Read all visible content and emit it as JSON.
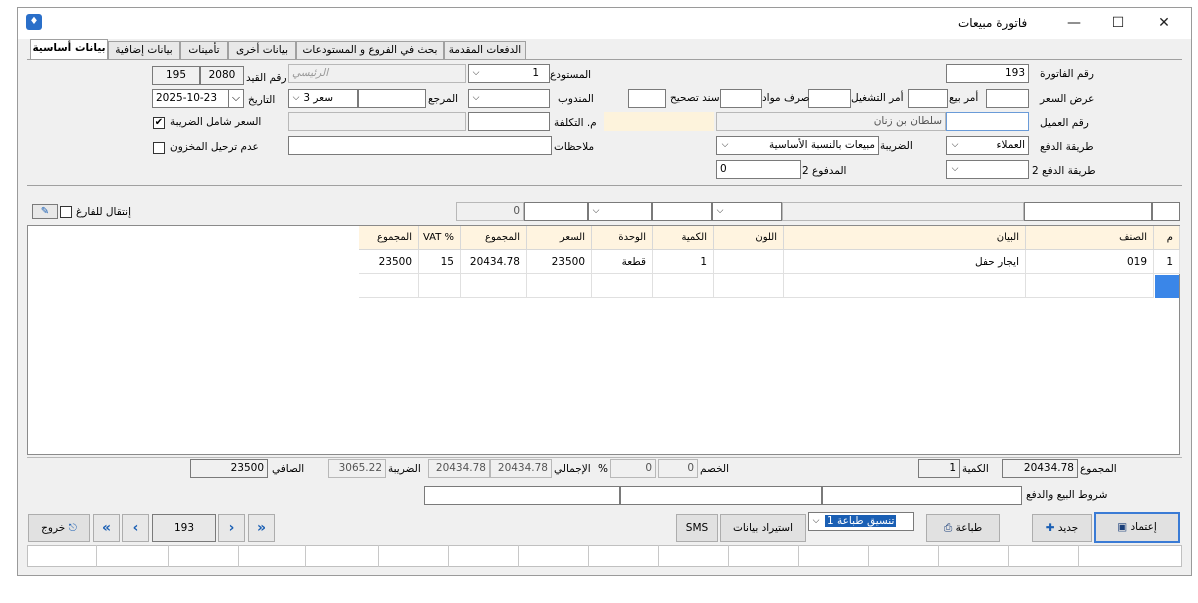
{
  "window": {
    "title": "فاتورة مبيعات",
    "minimize": "—",
    "maximize": "☐",
    "close": "✕"
  },
  "tabs": [
    {
      "label": "بيانات أساسية"
    },
    {
      "label": "بيانات إضافية"
    },
    {
      "label": "تأمينات"
    },
    {
      "label": "بيانات أخرى"
    },
    {
      "label": "بحث في الفروع و المستودعات"
    },
    {
      "label": "الدفعات المقدمة"
    }
  ],
  "form": {
    "invoice_no_label": "رقم الفاتورة",
    "invoice_no": "193",
    "price_offer_label": "عرض السعر",
    "sale_order_label": "أمر بيع",
    "operation_order_label": "أمر التشغيل",
    "material_issue_label": "صرف مواد",
    "adjustment_label": "سند تصحيح",
    "client_no_label": "رقم العميل",
    "client_name": "سلطان بن زنان",
    "payment_method_label": "طريقة الدفع",
    "payment_method": "العملاء",
    "tax_label": "الضريبة",
    "tax_value": "مبيعات بالنسبة الأساسية",
    "payment_method2_label": "طريقة الدفع 2",
    "paid2_label": "المدفوع 2",
    "paid2": "0",
    "warehouse_label": "المستودع",
    "warehouse_no": "1",
    "warehouse_name": "الرئيسي",
    "delegate_label": "المندوب",
    "reference_label": "المرجع",
    "price_level": "سعر 3",
    "cost_center_label": "م. التكلفة",
    "notes_label": "ملاحظات",
    "entry_no_label": "رقم القيد",
    "entry_no_a": "195",
    "entry_no_b": "2080",
    "date_label": "التاريخ",
    "date": "2025-10-23",
    "tax_inclusive_label": "السعر شامل الضريبة",
    "tax_inclusive_checked": "✔",
    "no_stock_posting_label": "عدم ترحيل المخزون"
  },
  "entry_row": {
    "qty_value": "0",
    "move_to_empty_label": "إنتقال للفارغ"
  },
  "grid": {
    "headers": [
      "م",
      "الصنف",
      "البيان",
      "اللون",
      "الكمية",
      "الوحدة",
      "السعر",
      "المجموع",
      "VAT %",
      "المجموع"
    ],
    "rows": [
      {
        "index": "1",
        "item": "019",
        "description": "ايجار حفل",
        "color": "",
        "qty": "1",
        "unit": "قطعة",
        "price": "23500",
        "subtotal": "20434.78",
        "vat": "15",
        "total": "23500"
      }
    ]
  },
  "totals": {
    "total_label": "المجموع",
    "total": "20434.78",
    "qty_label": "الكمية",
    "qty": "1",
    "discount_label": "الخصم",
    "discount": "0",
    "discount_pct": "0",
    "pct_sign": "%",
    "gross_label": "الإجمالي",
    "gross_a": "20434.78",
    "gross_b": "20434.78",
    "tax_label": "الضريبة",
    "tax": "3065.22",
    "net_label": "الصافي",
    "net": "23500"
  },
  "terms_label": "شروط البيع والدفع",
  "buttons": {
    "approve": "إعتماد",
    "new": "جديد",
    "print": "طباعة",
    "print_format": "تنسيق طباعة 1",
    "import": "استيراد بيانات",
    "sms": "SMS",
    "exit": "خروج",
    "record_no": "193"
  }
}
